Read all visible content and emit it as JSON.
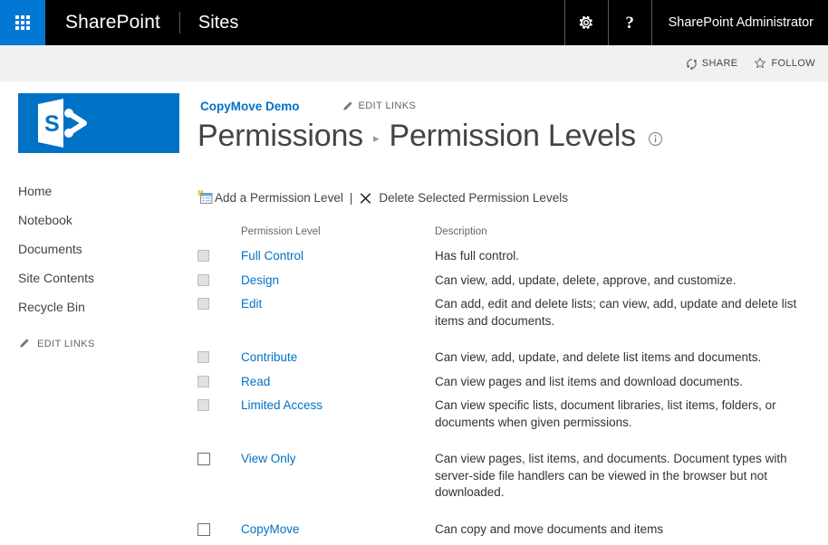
{
  "suite": {
    "waffle_icon": "app-launcher-waffle-icon",
    "brand": "SharePoint",
    "site_label": "Sites",
    "settings_icon": "gear-icon",
    "help_icon": "help-question-icon",
    "user": "SharePoint Administrator"
  },
  "ribbon": {
    "share_label": "SHARE",
    "share_icon": "share-circle-icon",
    "follow_label": "FOLLOW",
    "follow_icon": "star-outline-icon"
  },
  "site": {
    "logo_icon": "sharepoint-logo-icon",
    "breadcrumb_site": "CopyMove Demo",
    "edit_links_label": "EDIT LINKS",
    "edit_links_icon": "pencil-icon",
    "title_parent": "Permissions",
    "title_separator": "▸",
    "title_current": "Permission Levels",
    "info_icon": "info-circle-icon"
  },
  "nav": {
    "items": [
      {
        "label": "Home"
      },
      {
        "label": "Notebook"
      },
      {
        "label": "Documents"
      },
      {
        "label": "Site Contents"
      },
      {
        "label": "Recycle Bin"
      }
    ],
    "edit_links_label": "EDIT LINKS",
    "edit_links_icon": "pencil-icon"
  },
  "toolbar": {
    "add_label": "Add a Permission Level",
    "add_icon": "new-permission-level-icon",
    "divider": "|",
    "delete_label": "Delete Selected Permission Levels",
    "delete_icon": "delete-x-icon"
  },
  "table": {
    "headers": {
      "check": "",
      "name": "Permission Level",
      "description": "Description"
    },
    "rows": [
      {
        "name": "Full Control",
        "description": "Has full control.",
        "checkbox_state": "disabled",
        "gap_after": false
      },
      {
        "name": "Design",
        "description": "Can view, add, update, delete, approve, and customize.",
        "checkbox_state": "disabled",
        "gap_after": false
      },
      {
        "name": "Edit",
        "description": "Can add, edit and delete lists; can view, add, update and delete list items and documents.",
        "checkbox_state": "disabled",
        "gap_after": true
      },
      {
        "name": "Contribute",
        "description": "Can view, add, update, and delete list items and documents.",
        "checkbox_state": "disabled",
        "gap_after": false
      },
      {
        "name": "Read",
        "description": "Can view pages and list items and download documents.",
        "checkbox_state": "disabled",
        "gap_after": false
      },
      {
        "name": "Limited Access",
        "description": "Can view specific lists, document libraries, list items, folders, or documents when given permissions.",
        "checkbox_state": "disabled",
        "gap_after": true
      },
      {
        "name": "View Only",
        "description": "Can view pages, list items, and documents. Document types with server-side file handlers can be viewed in the browser but not downloaded.",
        "checkbox_state": "enabled",
        "gap_after": true
      },
      {
        "name": "CopyMove",
        "description": "Can copy and move documents and items",
        "checkbox_state": "enabled",
        "gap_after": false
      }
    ]
  },
  "colors": {
    "suite_bar": "#000000",
    "accent_blue": "#0072C6",
    "waffle_blue": "#0078D4",
    "ribbon_strip": "#F1F1F1",
    "text_dark": "#444444",
    "text_body": "#333333",
    "text_muted": "#666666"
  }
}
